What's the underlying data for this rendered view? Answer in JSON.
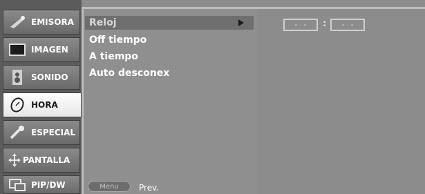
{
  "tabs": [
    {
      "label": "EMISORA",
      "icon": "satellite-dish-icon"
    },
    {
      "label": "IMAGEN",
      "icon": "tv-screen-icon"
    },
    {
      "label": "SONIDO",
      "icon": "speaker-icon"
    },
    {
      "label": "HORA",
      "icon": "clock-icon",
      "active": true
    },
    {
      "label": "ESPECIAL",
      "icon": "wand-icon"
    },
    {
      "label": "PANTALLA",
      "icon": "move-arrows-icon"
    },
    {
      "label": "PIP/DW",
      "icon": "pip-window-icon"
    }
  ],
  "menu": {
    "items": [
      {
        "label": "Reloj",
        "selected": true
      },
      {
        "label": "Off tiempo"
      },
      {
        "label": "A tiempo"
      },
      {
        "label": "Auto desconex"
      }
    ],
    "menu_button": "Menu",
    "prev_label": "Prev."
  },
  "time": {
    "hours": "- -",
    "minutes": "- -",
    "separator": ":"
  }
}
